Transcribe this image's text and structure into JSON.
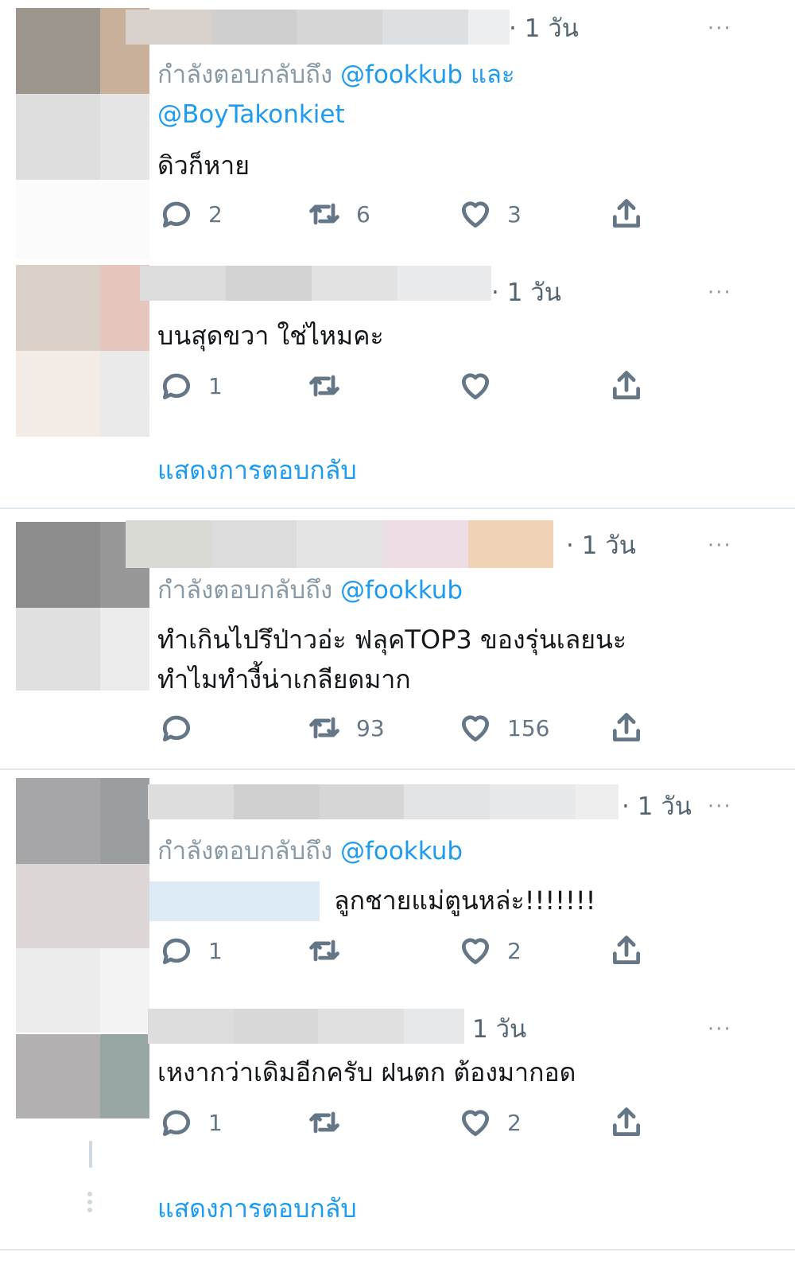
{
  "tweets": [
    {
      "time": "· 1 วัน",
      "reply_prefix": "กำลังตอบกลับถึง",
      "mention_1": "@fookkub",
      "and": "และ",
      "mention_2": "@BoyTakonkiet",
      "text": "ดิวก็หาย",
      "reply_count": "2",
      "retweet_count": "6",
      "like_count": "3"
    },
    {
      "time": "· 1 วัน",
      "text": "บนสุดขวา ใช่ไหมคะ",
      "reply_count": "1",
      "retweet_count": "",
      "like_count": ""
    },
    {
      "time": "· 1 วัน",
      "reply_prefix": "กำลังตอบกลับถึง",
      "mention_1": "@fookkub",
      "text_line_1": "ทำเกินไปรึป่าวอ่ะ ฟลุคTOP3 ของรุ่นเลยนะ",
      "text_line_2": "ทำไมทำงี้น่าเกลียดมาก",
      "reply_count": "",
      "retweet_count": "93",
      "like_count": "156"
    },
    {
      "time": "· 1 วัน",
      "reply_prefix": "กำลังตอบกลับถึง",
      "mention_1": "@fookkub",
      "text": "ลูกชายแม่ตูนหล่ะ!!!!!!!",
      "reply_count": "1",
      "retweet_count": "",
      "like_count": "2"
    },
    {
      "time": "1 วัน",
      "text": "เหงากว่าเดิมอีกครับ ฝนตก ต้องมากอด",
      "reply_count": "1",
      "retweet_count": "",
      "like_count": "2"
    }
  ],
  "more_icon": "···",
  "show_replies_1": "แสดงการตอบกลับ",
  "show_replies_2": "แสดงการตอบกลับ",
  "icons": [
    "reply-icon",
    "retweet-icon",
    "like-icon",
    "share-icon",
    "more-icon"
  ],
  "colors": {
    "link": "#1d9bf0",
    "muted": "#657786",
    "divider": "#e1e8ed"
  }
}
